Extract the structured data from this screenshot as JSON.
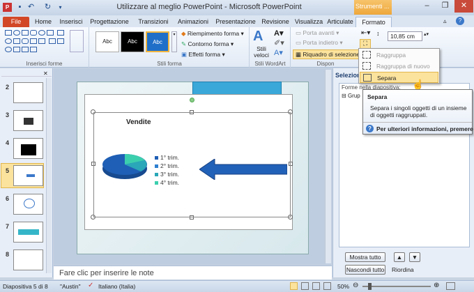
{
  "window": {
    "title": "Utilizzare al meglio PowerPoint  -  Microsoft PowerPoint",
    "context_tab_label": "Strumenti ...",
    "minimize": "–",
    "restore": "❐",
    "close": "✕"
  },
  "tabs": [
    "File",
    "Home",
    "Inserisci",
    "Progettazione",
    "Transizioni",
    "Animazioni",
    "Presentazione",
    "Revisione",
    "Visualizza",
    "Articulate",
    "Formato"
  ],
  "ribbon": {
    "groups": {
      "insert_shapes": "Inserisci forme",
      "shape_styles": "Stili forma",
      "wordart": "Stili WordArt",
      "arrange": "Dispon"
    },
    "style_samples": [
      "Abc",
      "Abc",
      "Abc"
    ],
    "fill": "Riempimento forma",
    "outline": "Contorno forma",
    "effects": "Effetti forma",
    "quick_styles": "Stili veloci",
    "bring_forward": "Porta avanti",
    "send_backward": "Porta indietro",
    "selection_pane": "Riquadro di selezione",
    "size_value": "10,85 cm"
  },
  "dropdown": {
    "items": [
      "Raggruppa",
      "Raggruppa di nuovo",
      "Separa"
    ]
  },
  "tooltip": {
    "title": "Separa",
    "body": "Separa i singoli oggetti di un insieme di oggetti raggruppati.",
    "help": "Per ulteriori informazioni, premere F1."
  },
  "slides": [
    "2",
    "3",
    "4",
    "5",
    "6",
    "7",
    "8"
  ],
  "chart": {
    "title": "Vendite",
    "legend": [
      "1° trim.",
      "2° trim.",
      "3° trim.",
      "4° trim."
    ]
  },
  "colors": {
    "legend": [
      "#1f5fb5",
      "#2d7fd0",
      "#2aa7b8",
      "#3ccfae"
    ],
    "accent": "#3aa8d8"
  },
  "notes_placeholder": "Fare clic per inserire le note",
  "selection_pane": {
    "title": "Selezione",
    "subtitle": "Forme nella diapositiva:",
    "item": "Grup",
    "show_all": "Mostra tutto",
    "hide_all": "Nascondi tutto",
    "reorder": "Riordina"
  },
  "status": {
    "slide": "Diapositiva 5 di 8",
    "theme": "\"Austin\"",
    "language": "Italiano (Italia)",
    "zoom": "50%"
  }
}
